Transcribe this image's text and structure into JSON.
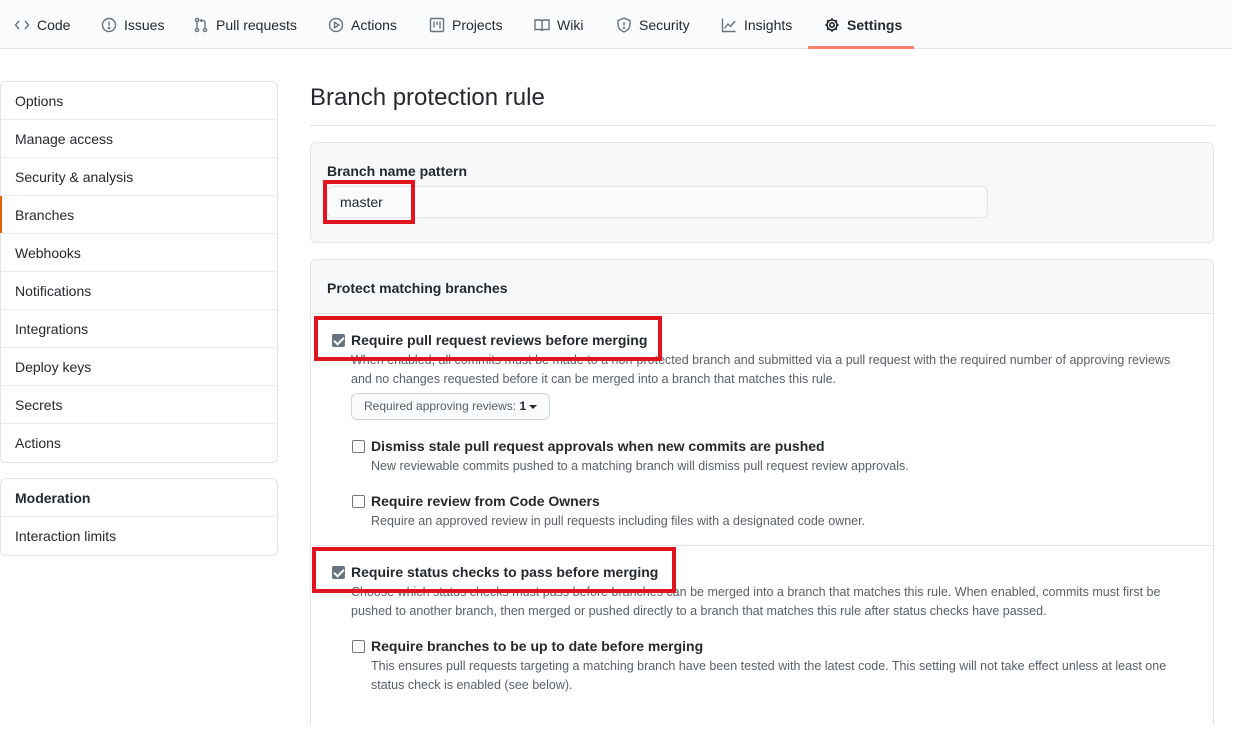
{
  "tabs": [
    {
      "label": "Code",
      "icon": "code-icon"
    },
    {
      "label": "Issues",
      "icon": "issue-icon"
    },
    {
      "label": "Pull requests",
      "icon": "pull-request-icon"
    },
    {
      "label": "Actions",
      "icon": "play-icon"
    },
    {
      "label": "Projects",
      "icon": "project-icon"
    },
    {
      "label": "Wiki",
      "icon": "book-icon"
    },
    {
      "label": "Security",
      "icon": "shield-icon"
    },
    {
      "label": "Insights",
      "icon": "graph-icon"
    },
    {
      "label": "Settings",
      "icon": "gear-icon"
    }
  ],
  "active_tab": "Settings",
  "accent_color": "#f9826c",
  "highlight_color": "#e0141e",
  "sidebar": {
    "items": [
      "Options",
      "Manage access",
      "Security & analysis",
      "Branches",
      "Webhooks",
      "Notifications",
      "Integrations",
      "Deploy keys",
      "Secrets",
      "Actions"
    ],
    "selected": "Branches",
    "moderation_heading": "Moderation",
    "moderation_items": [
      "Interaction limits"
    ]
  },
  "main": {
    "title": "Branch protection rule",
    "pattern_label": "Branch name pattern",
    "pattern_value": "master",
    "protect_heading": "Protect matching branches",
    "reviews": {
      "title": "Require pull request reviews before merging",
      "checked": true,
      "note": "When enabled, all commits must be made to a non-protected branch and submitted via a pull request with the required number of approving reviews and no changes requested before it can be merged into a branch that matches this rule.",
      "select_label": "Required approving reviews:",
      "select_value": "1"
    },
    "dismiss": {
      "title": "Dismiss stale pull request approvals when new commits are pushed",
      "checked": false,
      "note": "New reviewable commits pushed to a matching branch will dismiss pull request review approvals."
    },
    "code_owners": {
      "title": "Require review from Code Owners",
      "checked": false,
      "note": "Require an approved review in pull requests including files with a designated code owner."
    },
    "status_checks": {
      "title": "Require status checks to pass before merging",
      "checked": true,
      "note": "Choose which status checks must pass before branches can be merged into a branch that matches this rule. When enabled, commits must first be pushed to another branch, then merged or pushed directly to a branch that matches this rule after status checks have passed."
    },
    "up_to_date": {
      "title": "Require branches to be up to date before merging",
      "checked": false,
      "note": "This ensures pull requests targeting a matching branch have been tested with the latest code. This setting will not take effect unless at least one status check is enabled (see below)."
    }
  }
}
